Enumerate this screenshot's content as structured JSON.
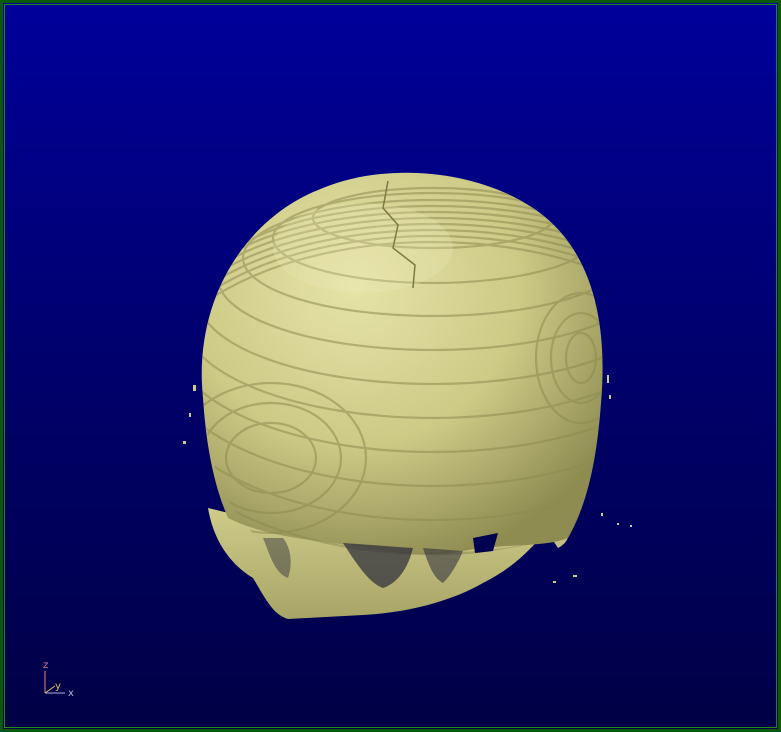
{
  "viewer": {
    "background_top": "#00009a",
    "background_bottom": "#000045",
    "border_color": "#0b5a0b",
    "model": {
      "name": "skull-isosurface",
      "color": "#d6d38f"
    },
    "axes": {
      "z_label": "z",
      "y_label": "y",
      "x_label": "x",
      "z_color": "#e08080",
      "y_color": "#e0c060",
      "x_color": "#b0b0e0"
    }
  }
}
